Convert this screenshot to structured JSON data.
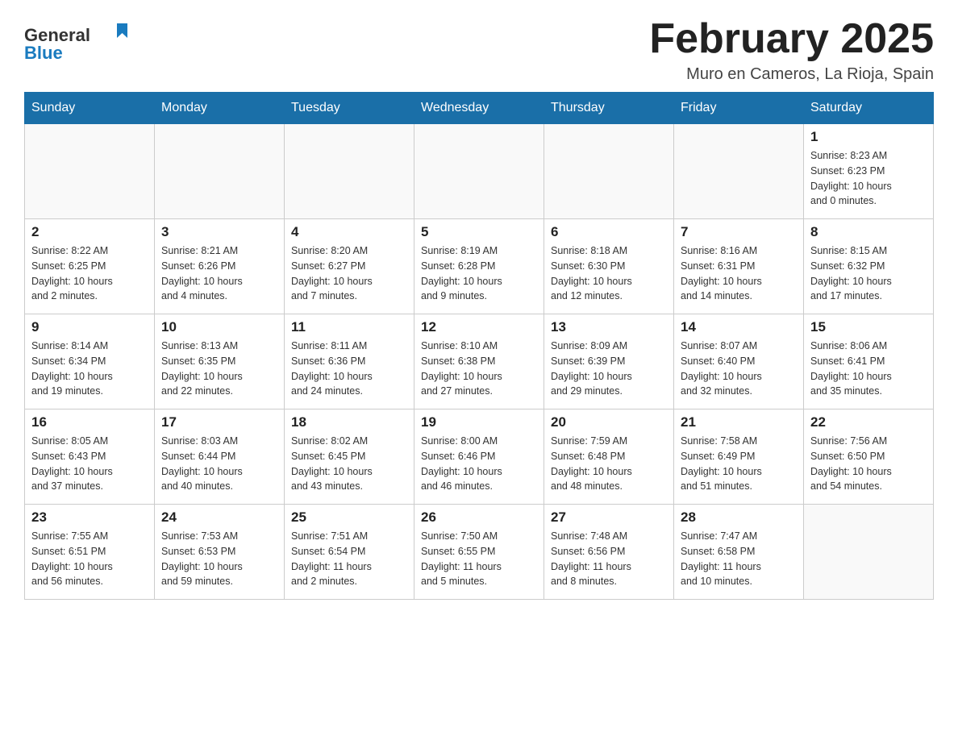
{
  "header": {
    "logo_general": "General",
    "logo_blue": "Blue",
    "title": "February 2025",
    "subtitle": "Muro en Cameros, La Rioja, Spain"
  },
  "weekdays": [
    "Sunday",
    "Monday",
    "Tuesday",
    "Wednesday",
    "Thursday",
    "Friday",
    "Saturday"
  ],
  "weeks": [
    [
      {
        "day": "",
        "info": ""
      },
      {
        "day": "",
        "info": ""
      },
      {
        "day": "",
        "info": ""
      },
      {
        "day": "",
        "info": ""
      },
      {
        "day": "",
        "info": ""
      },
      {
        "day": "",
        "info": ""
      },
      {
        "day": "1",
        "info": "Sunrise: 8:23 AM\nSunset: 6:23 PM\nDaylight: 10 hours\nand 0 minutes."
      }
    ],
    [
      {
        "day": "2",
        "info": "Sunrise: 8:22 AM\nSunset: 6:25 PM\nDaylight: 10 hours\nand 2 minutes."
      },
      {
        "day": "3",
        "info": "Sunrise: 8:21 AM\nSunset: 6:26 PM\nDaylight: 10 hours\nand 4 minutes."
      },
      {
        "day": "4",
        "info": "Sunrise: 8:20 AM\nSunset: 6:27 PM\nDaylight: 10 hours\nand 7 minutes."
      },
      {
        "day": "5",
        "info": "Sunrise: 8:19 AM\nSunset: 6:28 PM\nDaylight: 10 hours\nand 9 minutes."
      },
      {
        "day": "6",
        "info": "Sunrise: 8:18 AM\nSunset: 6:30 PM\nDaylight: 10 hours\nand 12 minutes."
      },
      {
        "day": "7",
        "info": "Sunrise: 8:16 AM\nSunset: 6:31 PM\nDaylight: 10 hours\nand 14 minutes."
      },
      {
        "day": "8",
        "info": "Sunrise: 8:15 AM\nSunset: 6:32 PM\nDaylight: 10 hours\nand 17 minutes."
      }
    ],
    [
      {
        "day": "9",
        "info": "Sunrise: 8:14 AM\nSunset: 6:34 PM\nDaylight: 10 hours\nand 19 minutes."
      },
      {
        "day": "10",
        "info": "Sunrise: 8:13 AM\nSunset: 6:35 PM\nDaylight: 10 hours\nand 22 minutes."
      },
      {
        "day": "11",
        "info": "Sunrise: 8:11 AM\nSunset: 6:36 PM\nDaylight: 10 hours\nand 24 minutes."
      },
      {
        "day": "12",
        "info": "Sunrise: 8:10 AM\nSunset: 6:38 PM\nDaylight: 10 hours\nand 27 minutes."
      },
      {
        "day": "13",
        "info": "Sunrise: 8:09 AM\nSunset: 6:39 PM\nDaylight: 10 hours\nand 29 minutes."
      },
      {
        "day": "14",
        "info": "Sunrise: 8:07 AM\nSunset: 6:40 PM\nDaylight: 10 hours\nand 32 minutes."
      },
      {
        "day": "15",
        "info": "Sunrise: 8:06 AM\nSunset: 6:41 PM\nDaylight: 10 hours\nand 35 minutes."
      }
    ],
    [
      {
        "day": "16",
        "info": "Sunrise: 8:05 AM\nSunset: 6:43 PM\nDaylight: 10 hours\nand 37 minutes."
      },
      {
        "day": "17",
        "info": "Sunrise: 8:03 AM\nSunset: 6:44 PM\nDaylight: 10 hours\nand 40 minutes."
      },
      {
        "day": "18",
        "info": "Sunrise: 8:02 AM\nSunset: 6:45 PM\nDaylight: 10 hours\nand 43 minutes."
      },
      {
        "day": "19",
        "info": "Sunrise: 8:00 AM\nSunset: 6:46 PM\nDaylight: 10 hours\nand 46 minutes."
      },
      {
        "day": "20",
        "info": "Sunrise: 7:59 AM\nSunset: 6:48 PM\nDaylight: 10 hours\nand 48 minutes."
      },
      {
        "day": "21",
        "info": "Sunrise: 7:58 AM\nSunset: 6:49 PM\nDaylight: 10 hours\nand 51 minutes."
      },
      {
        "day": "22",
        "info": "Sunrise: 7:56 AM\nSunset: 6:50 PM\nDaylight: 10 hours\nand 54 minutes."
      }
    ],
    [
      {
        "day": "23",
        "info": "Sunrise: 7:55 AM\nSunset: 6:51 PM\nDaylight: 10 hours\nand 56 minutes."
      },
      {
        "day": "24",
        "info": "Sunrise: 7:53 AM\nSunset: 6:53 PM\nDaylight: 10 hours\nand 59 minutes."
      },
      {
        "day": "25",
        "info": "Sunrise: 7:51 AM\nSunset: 6:54 PM\nDaylight: 11 hours\nand 2 minutes."
      },
      {
        "day": "26",
        "info": "Sunrise: 7:50 AM\nSunset: 6:55 PM\nDaylight: 11 hours\nand 5 minutes."
      },
      {
        "day": "27",
        "info": "Sunrise: 7:48 AM\nSunset: 6:56 PM\nDaylight: 11 hours\nand 8 minutes."
      },
      {
        "day": "28",
        "info": "Sunrise: 7:47 AM\nSunset: 6:58 PM\nDaylight: 11 hours\nand 10 minutes."
      },
      {
        "day": "",
        "info": ""
      }
    ]
  ]
}
